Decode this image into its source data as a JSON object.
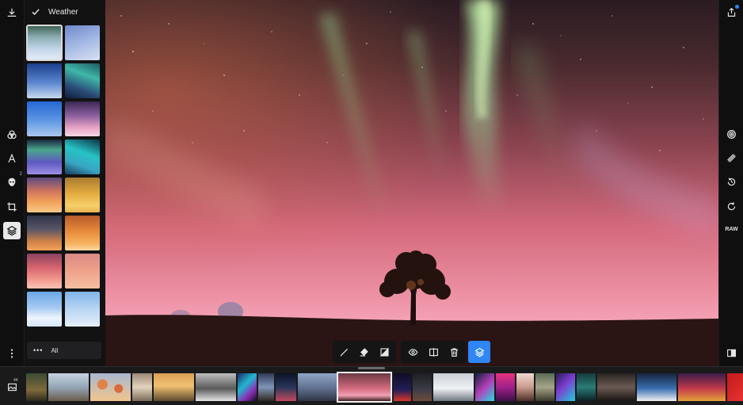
{
  "filter_panel": {
    "title": "Weather",
    "all_label": "All",
    "thumbnails": [
      {
        "name": "aurora-preset-1"
      },
      {
        "name": "sky-preset-2"
      },
      {
        "name": "blue-cloud-preset-3"
      },
      {
        "name": "teal-aurora-preset-4"
      },
      {
        "name": "blue-sky-preset-5"
      },
      {
        "name": "purple-dusk-preset-6"
      },
      {
        "name": "green-aurora-preset-7"
      },
      {
        "name": "cyan-aurora-preset-8"
      },
      {
        "name": "orange-sunset-preset-9"
      },
      {
        "name": "golden-clouds-preset-10"
      },
      {
        "name": "storm-sunset-preset-11"
      },
      {
        "name": "orange-horizon-preset-12"
      },
      {
        "name": "pink-clouds-preset-13"
      },
      {
        "name": "peach-sky-preset-14"
      },
      {
        "name": "light-blue-clouds-preset-15"
      },
      {
        "name": "soft-blue-clouds-preset-16"
      }
    ]
  },
  "left_rail": {
    "tools": [
      {
        "name": "download-icon"
      },
      {
        "name": "filters-icon"
      },
      {
        "name": "text-icon",
        "glyph": "A"
      },
      {
        "name": "retouch-face-icon",
        "superscript": "2"
      },
      {
        "name": "crop-icon"
      },
      {
        "name": "layers-icon"
      },
      {
        "name": "more-options-icon"
      }
    ]
  },
  "right_rail": {
    "raw_label": "RAW"
  },
  "filmstrip": {
    "gallery_count": "44"
  },
  "colors": {
    "accent": "#2f86f6",
    "background": "#0b0b0c",
    "panel": "#121213"
  }
}
